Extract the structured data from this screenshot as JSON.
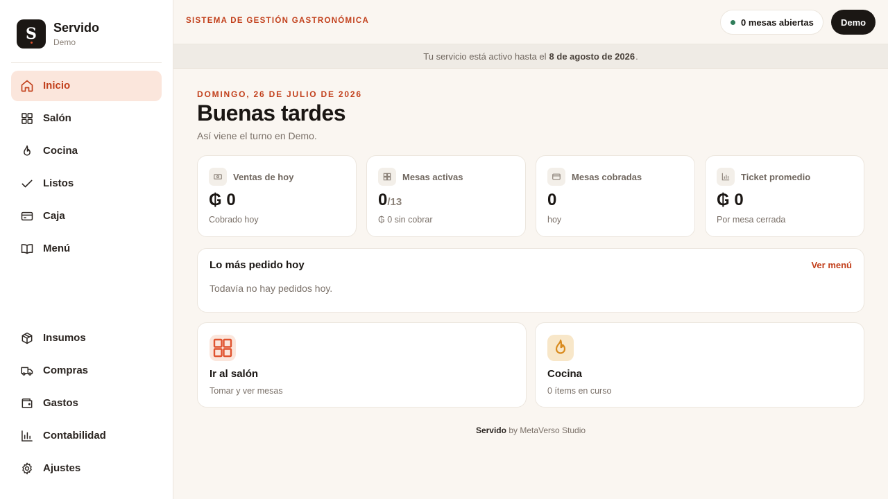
{
  "brand": {
    "initial": "S",
    "name": "Servido",
    "sub": "Demo"
  },
  "nav_top": [
    {
      "label": "Inicio",
      "icon": "home-icon",
      "active": true
    },
    {
      "label": "Salón",
      "icon": "grid-icon"
    },
    {
      "label": "Cocina",
      "icon": "flame-icon"
    },
    {
      "label": "Listos",
      "icon": "check-icon"
    },
    {
      "label": "Caja",
      "icon": "card-icon"
    },
    {
      "label": "Menú",
      "icon": "book-icon"
    }
  ],
  "nav_bottom": [
    {
      "label": "Insumos",
      "icon": "box-icon"
    },
    {
      "label": "Compras",
      "icon": "truck-icon"
    },
    {
      "label": "Gastos",
      "icon": "wallet-icon"
    },
    {
      "label": "Contabilidad",
      "icon": "bar-chart-icon"
    },
    {
      "label": "Ajustes",
      "icon": "gear-icon"
    }
  ],
  "header": {
    "system_title": "SISTEMA DE GESTIÓN GASTRONÓMICA",
    "open_tables": "0 mesas abiertas",
    "user": "Demo"
  },
  "banner": {
    "prefix": "Tu servicio está activo hasta el",
    "date": "8 de agosto de 2026",
    "suffix": "."
  },
  "main": {
    "date": "DOMINGO, 26 DE JULIO DE 2026",
    "greeting": "Buenas tardes",
    "subtitle": "Así viene el turno en Demo."
  },
  "stats": {
    "sales": {
      "label": "Ventas de hoy",
      "value": "₲ 0",
      "note": "Cobrado hoy",
      "icon": "cash-icon"
    },
    "active": {
      "label": "Mesas activas",
      "value": "0",
      "total": "/13",
      "note": "₲ 0 sin cobrar",
      "icon": "grid-icon"
    },
    "charged": {
      "label": "Mesas cobradas",
      "value": "0",
      "note": "hoy",
      "icon": "card-icon"
    },
    "ticket": {
      "label": "Ticket promedio",
      "value": "₲ 0",
      "note": "Por mesa cerrada",
      "icon": "bar-chart-icon"
    }
  },
  "popular": {
    "title": "Lo más pedido hoy",
    "link": "Ver menú",
    "empty": "Todavía no hay pedidos hoy."
  },
  "actions": {
    "salon": {
      "title": "Ir al salón",
      "note": "Tomar y ver mesas",
      "color": "#e0532f"
    },
    "kitchen": {
      "title": "Cocina",
      "note": "0 ítems en curso",
      "color": "#d98a1c"
    }
  },
  "footer": {
    "brand": "Servido",
    "by": "by MetaVerso Studio"
  },
  "colors": {
    "accent": "#c2401c",
    "active_bg": "#fbe6dc",
    "status_green": "#2f7d5a",
    "dark": "#1b1714"
  }
}
